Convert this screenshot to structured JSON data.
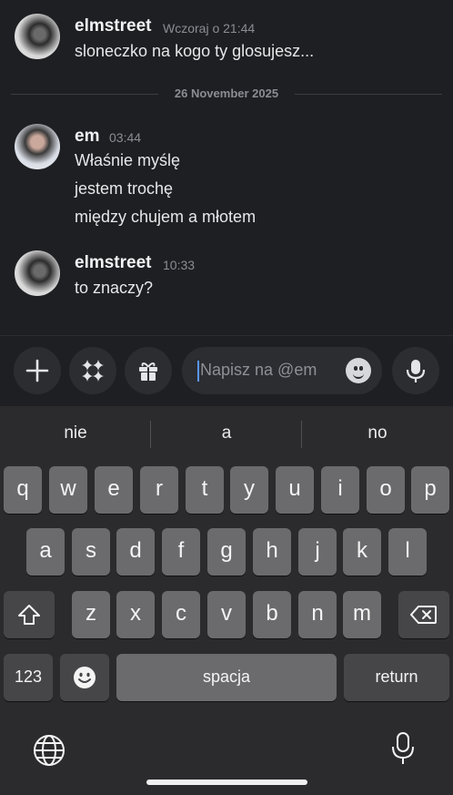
{
  "messages": [
    {
      "author": "elmstreet",
      "time": "Wczoraj o 21:44",
      "lines": [
        "sloneczko na kogo ty glosujesz..."
      ]
    },
    {
      "author": "em",
      "time": "03:44",
      "lines": [
        "Właśnie myślę",
        "jestem trochę",
        "między chujem a młotem"
      ]
    },
    {
      "author": "elmstreet",
      "time": "10:33",
      "lines": [
        "to znaczy?"
      ]
    }
  ],
  "date_divider": "26 November 2025",
  "composer": {
    "placeholder": "Napisz na @em"
  },
  "keyboard": {
    "suggestions": [
      "nie",
      "a",
      "no"
    ],
    "row1": [
      "q",
      "w",
      "e",
      "r",
      "t",
      "y",
      "u",
      "i",
      "o",
      "p"
    ],
    "row2": [
      "a",
      "s",
      "d",
      "f",
      "g",
      "h",
      "j",
      "k",
      "l"
    ],
    "row3": [
      "z",
      "x",
      "c",
      "v",
      "b",
      "n",
      "m"
    ],
    "numbers": "123",
    "space": "spacja",
    "return": "return"
  },
  "icons": {
    "add": "plus-icon",
    "apps": "sparkles-icon",
    "gift": "gift-icon",
    "emoji": "smiley-icon",
    "voice": "microphone-icon",
    "shift": "shift-icon",
    "backspace": "backspace-icon",
    "globe": "globe-icon",
    "dictation": "microphone-icon"
  },
  "colors": {
    "background": "#1e1f22",
    "caret": "#5a96ff",
    "timestamp": "#8a8d93"
  }
}
